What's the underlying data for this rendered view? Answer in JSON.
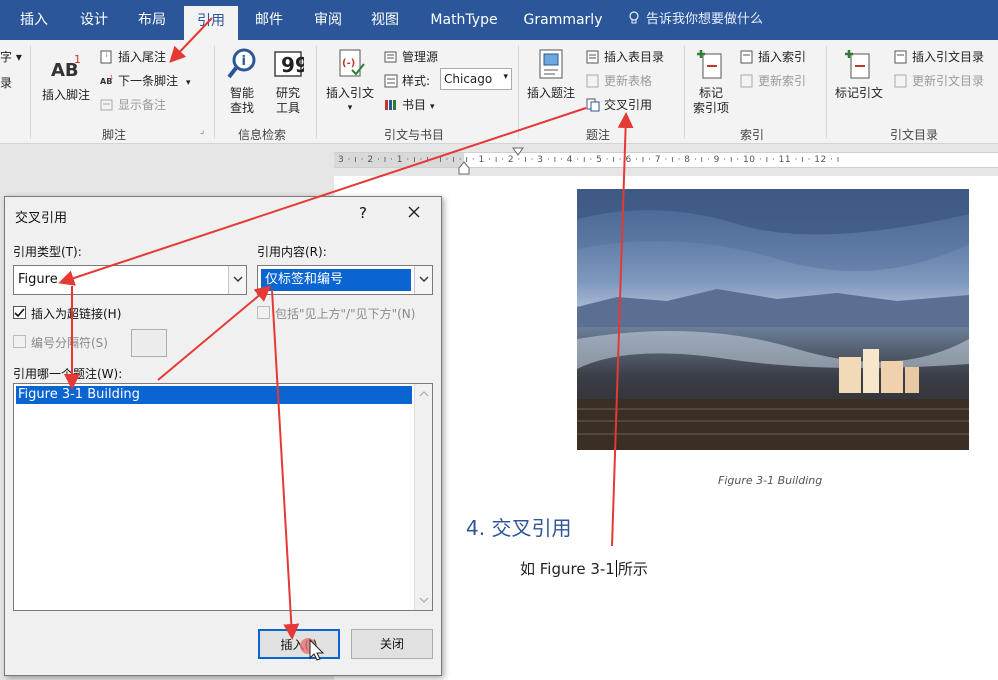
{
  "tabs": {
    "insert": "插入",
    "design": "设计",
    "layout": "布局",
    "references": "引用",
    "mailings": "邮件",
    "review": "审阅",
    "view": "视图",
    "mathtype": "MathType",
    "grammarly": "Grammarly",
    "tell_me": "告诉我你想要做什么"
  },
  "ribbon": {
    "cut_a": "字 ▾",
    "cut_b": "录",
    "insert_footnote": "插入脚注",
    "insert_endnote": "插入尾注",
    "next_footnote": "下一条脚注",
    "show_notes": "显示备注",
    "footnotes_group": "脚注",
    "smart_lookup_1": "智能",
    "smart_lookup_2": "查找",
    "research_1": "研究",
    "research_2": "工具",
    "research_group": "信息检索",
    "insert_citation": "插入引文",
    "manage_sources": "管理源",
    "style_label": "样式:",
    "style_value": "Chicago",
    "bibliography": "书目",
    "citations_group": "引文与书目",
    "insert_caption": "插入题注",
    "insert_table_of_figures": "插入表目录",
    "update_table": "更新表格",
    "cross_reference": "交叉引用",
    "captions_group": "题注",
    "mark_entry_1": "标记",
    "mark_entry_2": "索引项",
    "insert_index": "插入索引",
    "update_index": "更新索引",
    "index_group": "索引",
    "mark_citation": "标记引文",
    "insert_toa": "插入引文目录",
    "update_toa": "更新引文目录",
    "toa_group": "引文目录"
  },
  "ruler": {
    "ticks": "3 · ı · 2 · ı · 1 · ı · ı · ı · ı · ı · 1 · ı · 2 · ı · 3 · ı · 4 · ı · 5 · ı · 6 · ı · 7 · ı · 8 · ı · 9 · ı · 10 · ı · 11 · ı · 12 · ı"
  },
  "document": {
    "caption": "Figure 3-1 Building",
    "heading": "4. 交叉引用",
    "body_before": "如 Figure 3-1",
    "body_after": "所示"
  },
  "dialog": {
    "title": "交叉引用",
    "help": "?",
    "ref_type_label": "引用类型(T):",
    "ref_type_value": "Figure",
    "ref_content_label": "引用内容(R):",
    "ref_content_value": "仅标签和编号",
    "insert_hyperlink_label": "插入为超链接(H)",
    "include_above_below_label": "包括\"见上方\"/\"见下方\"(N)",
    "separate_numbers_label": "编号分隔符(S)",
    "which_caption_label": "引用哪一个题注(W):",
    "list_items": [
      "Figure 3-1 Building"
    ],
    "insert_button": "插入(I)",
    "close_button": "关闭"
  },
  "colors": {
    "tabbar": "#2b579a",
    "heading": "#2f5597",
    "selection": "#0a64d2",
    "annotation": "#e53935"
  }
}
